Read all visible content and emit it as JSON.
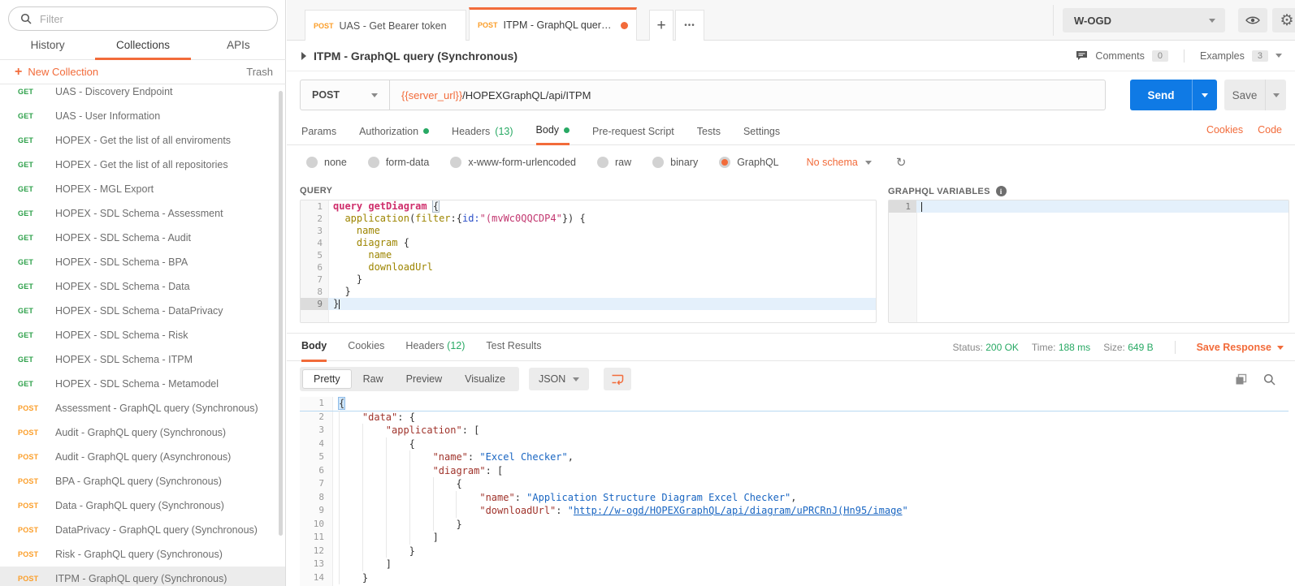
{
  "colors": {
    "accent": "#f26b3a",
    "get": "#2ca049",
    "post": "#fb9e29",
    "send_blue": "#0f7ae5",
    "success_green": "#28a964",
    "key_red": "#a0342c",
    "value_blue": "#1a66c2"
  },
  "sidebar": {
    "filter_placeholder": "Filter",
    "tabs": [
      "History",
      "Collections",
      "APIs"
    ],
    "active_tab": "Collections",
    "new_collection_label": "New Collection",
    "trash_label": "Trash",
    "items": [
      {
        "method": "GET",
        "name": "UAS - Discovery Endpoint"
      },
      {
        "method": "GET",
        "name": "UAS - User Information"
      },
      {
        "method": "GET",
        "name": "HOPEX - Get the list of all enviroments"
      },
      {
        "method": "GET",
        "name": "HOPEX - Get the list of all repositories"
      },
      {
        "method": "GET",
        "name": "HOPEX - MGL Export"
      },
      {
        "method": "GET",
        "name": "HOPEX - SDL Schema - Assessment"
      },
      {
        "method": "GET",
        "name": "HOPEX - SDL Schema - Audit"
      },
      {
        "method": "GET",
        "name": "HOPEX - SDL Schema - BPA"
      },
      {
        "method": "GET",
        "name": "HOPEX - SDL Schema - Data"
      },
      {
        "method": "GET",
        "name": "HOPEX - SDL Schema - DataPrivacy"
      },
      {
        "method": "GET",
        "name": "HOPEX - SDL Schema - Risk"
      },
      {
        "method": "GET",
        "name": "HOPEX - SDL Schema - ITPM"
      },
      {
        "method": "GET",
        "name": "HOPEX - SDL Schema - Metamodel"
      },
      {
        "method": "POST",
        "name": "Assessment - GraphQL query (Synchronous)"
      },
      {
        "method": "POST",
        "name": "Audit - GraphQL query (Synchronous)"
      },
      {
        "method": "POST",
        "name": "Audit - GraphQL query (Asynchronous)"
      },
      {
        "method": "POST",
        "name": "BPA - GraphQL query (Synchronous)"
      },
      {
        "method": "POST",
        "name": "Data - GraphQL query (Synchronous)"
      },
      {
        "method": "POST",
        "name": "DataPrivacy - GraphQL query (Synchronous)"
      },
      {
        "method": "POST",
        "name": "Risk - GraphQL query (Synchronous)"
      },
      {
        "method": "POST",
        "name": "ITPM - GraphQL query (Synchronous)",
        "selected": true
      }
    ]
  },
  "topbar": {
    "tabs": [
      {
        "method": "POST",
        "label": "UAS - Get Bearer token",
        "active": false,
        "dirty": false
      },
      {
        "method": "POST",
        "label": "ITPM - GraphQL query (Synchr...",
        "active": true,
        "dirty": true
      }
    ],
    "new_tab_glyph": "+",
    "more_glyph": "•••",
    "workspace": "W-OGD"
  },
  "request": {
    "title": "ITPM - GraphQL query (Synchronous)",
    "comments_label": "Comments",
    "comments_count": "0",
    "examples_label": "Examples",
    "examples_count": "3",
    "method": "POST",
    "url_var": "{{server_url}}",
    "url_rest": "/HOPEXGraphQL/api/ITPM",
    "send_label": "Send",
    "save_label": "Save",
    "cookies_label": "Cookies",
    "code_label": "Code",
    "tabs": [
      {
        "label": "Params"
      },
      {
        "label": "Authorization",
        "dot": true
      },
      {
        "label": "Headers",
        "count": "(13)"
      },
      {
        "label": "Body",
        "dot": true,
        "active": true
      },
      {
        "label": "Pre-request Script"
      },
      {
        "label": "Tests"
      },
      {
        "label": "Settings"
      }
    ],
    "body_modes": [
      "none",
      "form-data",
      "x-www-form-urlencoded",
      "raw",
      "binary",
      "GraphQL"
    ],
    "selected_mode": "GraphQL",
    "schema_label": "No schema",
    "refresh_glyph": "↻"
  },
  "query_editor": {
    "label": "QUERY",
    "lines": [
      {
        "n": 1,
        "tokens": [
          [
            "kw",
            "query"
          ],
          [
            "pl",
            " "
          ],
          [
            "def",
            "getDiagram"
          ],
          [
            "pl",
            " "
          ],
          [
            "mt",
            "{"
          ]
        ]
      },
      {
        "n": 2,
        "tokens": [
          [
            "pl",
            "  "
          ],
          [
            "fld",
            "application"
          ],
          [
            "pl",
            "("
          ],
          [
            "fld",
            "filter"
          ],
          [
            "pl",
            ":{"
          ],
          [
            "attr",
            "id:"
          ],
          [
            "str",
            "\"(mvWc0QQCDP4\""
          ],
          [
            "pl",
            "}) {"
          ]
        ]
      },
      {
        "n": 3,
        "tokens": [
          [
            "pl",
            "    "
          ],
          [
            "fld",
            "name"
          ]
        ]
      },
      {
        "n": 4,
        "tokens": [
          [
            "pl",
            "    "
          ],
          [
            "fld",
            "diagram"
          ],
          [
            "pl",
            " {"
          ]
        ]
      },
      {
        "n": 5,
        "tokens": [
          [
            "pl",
            "      "
          ],
          [
            "fld",
            "name"
          ]
        ]
      },
      {
        "n": 6,
        "tokens": [
          [
            "pl",
            "      "
          ],
          [
            "fld",
            "downloadUrl"
          ]
        ]
      },
      {
        "n": 7,
        "tokens": [
          [
            "pl",
            "    }"
          ]
        ]
      },
      {
        "n": 8,
        "tokens": [
          [
            "pl",
            "  }"
          ]
        ]
      },
      {
        "n": 9,
        "tokens": [
          [
            "pl",
            "}"
          ]
        ],
        "active": true,
        "caret": true
      }
    ]
  },
  "variables_editor": {
    "label": "GRAPHQL VARIABLES",
    "lines": [
      {
        "n": 1,
        "tokens": [],
        "active": true,
        "caret": true
      }
    ]
  },
  "response": {
    "tabs": [
      {
        "label": "Body",
        "active": true
      },
      {
        "label": "Cookies"
      },
      {
        "label": "Headers",
        "count": "(12)"
      },
      {
        "label": "Test Results"
      }
    ],
    "status_label": "Status:",
    "status_value": "200 OK",
    "time_label": "Time:",
    "time_value": "188 ms",
    "size_label": "Size:",
    "size_value": "649 B",
    "save_response_label": "Save Response",
    "view_modes": [
      "Pretty",
      "Raw",
      "Preview",
      "Visualize"
    ],
    "active_view_mode": "Pretty",
    "format": "JSON",
    "lines": [
      {
        "n": 1,
        "guides": 0,
        "sel": true,
        "tokens": [
          [
            "mt2",
            "{"
          ]
        ]
      },
      {
        "n": 2,
        "guides": 1,
        "tokens": [
          [
            "key",
            "\"data\""
          ],
          [
            "pl",
            ": {"
          ]
        ]
      },
      {
        "n": 3,
        "guides": 2,
        "tokens": [
          [
            "key",
            "\"application\""
          ],
          [
            "pl",
            ": ["
          ]
        ]
      },
      {
        "n": 4,
        "guides": 3,
        "tokens": [
          [
            "pl",
            "{"
          ]
        ]
      },
      {
        "n": 5,
        "guides": 4,
        "tokens": [
          [
            "key",
            "\"name\""
          ],
          [
            "pl",
            ": "
          ],
          [
            "val",
            "\"Excel Checker\""
          ],
          [
            "pl",
            ","
          ]
        ]
      },
      {
        "n": 6,
        "guides": 4,
        "tokens": [
          [
            "key",
            "\"diagram\""
          ],
          [
            "pl",
            ": ["
          ]
        ]
      },
      {
        "n": 7,
        "guides": 5,
        "tokens": [
          [
            "pl",
            "{"
          ]
        ]
      },
      {
        "n": 8,
        "guides": 6,
        "tokens": [
          [
            "key",
            "\"name\""
          ],
          [
            "pl",
            ": "
          ],
          [
            "val",
            "\"Application Structure Diagram Excel Checker\""
          ],
          [
            "pl",
            ","
          ]
        ]
      },
      {
        "n": 9,
        "guides": 6,
        "tokens": [
          [
            "key",
            "\"downloadUrl\""
          ],
          [
            "pl",
            ": "
          ],
          [
            "val",
            "\""
          ],
          [
            "link",
            "http://w-ogd/HOPEXGraphQL/api/diagram/uPRCRnJ(Hn95/image"
          ],
          [
            "val",
            "\""
          ]
        ]
      },
      {
        "n": 10,
        "guides": 5,
        "tokens": [
          [
            "pl",
            "}"
          ]
        ]
      },
      {
        "n": 11,
        "guides": 4,
        "tokens": [
          [
            "pl",
            "]"
          ]
        ]
      },
      {
        "n": 12,
        "guides": 3,
        "tokens": [
          [
            "pl",
            "}"
          ]
        ]
      },
      {
        "n": 13,
        "guides": 2,
        "tokens": [
          [
            "pl",
            "]"
          ]
        ]
      },
      {
        "n": 14,
        "guides": 1,
        "tokens": [
          [
            "pl",
            "}"
          ]
        ]
      }
    ]
  }
}
